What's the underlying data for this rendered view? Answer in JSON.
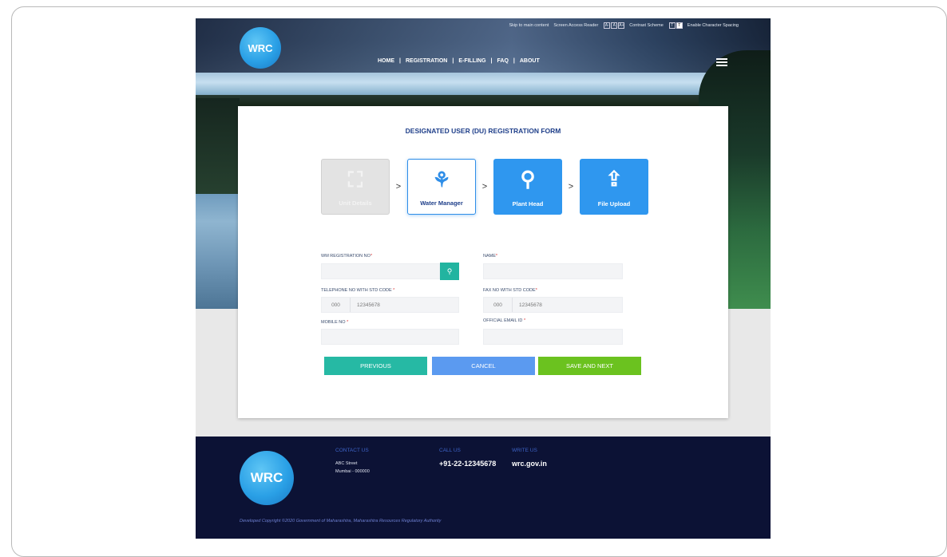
{
  "header": {
    "logo_text": "WRC",
    "utility": {
      "skip": "Skip to main content",
      "screen_reader": "Screen Access Reader",
      "font_boxes": [
        "A-",
        "A",
        "A+"
      ],
      "contrast": "Contrast Scheme",
      "contrast_boxes": [
        "T",
        "T"
      ],
      "spacing": "Enable Character Spacing"
    },
    "nav": [
      "HOME",
      "|",
      "REGISTRATION",
      "|",
      "E-FILLING",
      "|",
      "FAQ",
      "|",
      "ABOUT"
    ]
  },
  "form": {
    "title": "DESIGNATED USER (DU) REGISTRATION FORM",
    "steps": [
      {
        "label": "Unit Details",
        "icon": "⛶",
        "state": "disabled"
      },
      {
        "label": "Water Manager",
        "icon": "⚘",
        "state": "active"
      },
      {
        "label": "Plant Head",
        "icon": "⚲",
        "state": "todo"
      },
      {
        "label": "File Upload",
        "icon": "⇪",
        "state": "todo"
      }
    ],
    "arrow": ">",
    "fields": {
      "wm_reg": {
        "label": "WM REGISTRATION NO",
        "value": ""
      },
      "name": {
        "label": "NAME",
        "value": ""
      },
      "telephone": {
        "label": "TELEPHONE NO WITH STD CODE ",
        "std": "000",
        "number": "12345678"
      },
      "fax": {
        "label": "FAX NO WITH STD CODE",
        "std": "000",
        "number": "12345678"
      },
      "mobile": {
        "label": "MOBILE NO ",
        "value": ""
      },
      "email": {
        "label": "OFFICIAL EMAIL ID ",
        "value": ""
      }
    },
    "required_mark": "*",
    "buttons": {
      "previous": "PREVIOUS",
      "cancel": "CANCEL",
      "next": "SAVE AND NEXT"
    }
  },
  "footer": {
    "logo_text": "WRC",
    "contact": {
      "heading": "CONTACT US",
      "line1": "ABC Street",
      "line2": "Mumbai - 000000"
    },
    "call": {
      "heading": "CALL US",
      "value": "+91-22-12345678"
    },
    "write": {
      "heading": "WRITE US",
      "value": "wrc.gov.in"
    },
    "copyright": "Developed Copyright ©2020 Government of Maharashtra, Maharashtra Resources Regulatory Authority"
  },
  "colors": {
    "accent": "#2f97ef",
    "teal": "#26b9a4",
    "green": "#6bc21f",
    "footer_bg": "#0c1235",
    "title": "#1f3f8a"
  },
  "icons": {
    "search": "search-icon",
    "menu": "hamburger-menu-icon"
  }
}
